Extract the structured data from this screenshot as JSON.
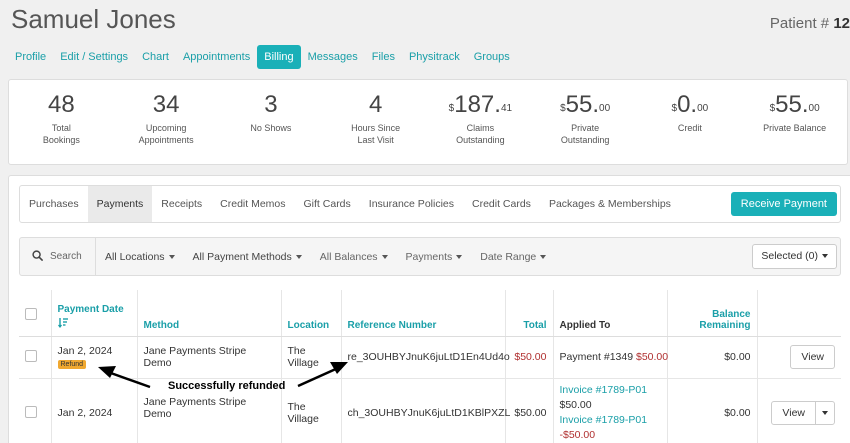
{
  "patient": {
    "name": "Samuel Jones",
    "number_label": "Patient # ",
    "number": "12"
  },
  "nav": {
    "tabs": [
      {
        "label": "Profile"
      },
      {
        "label": "Edit / Settings"
      },
      {
        "label": "Chart"
      },
      {
        "label": "Appointments"
      },
      {
        "label": "Billing",
        "active": true
      },
      {
        "label": "Messages"
      },
      {
        "label": "Files"
      },
      {
        "label": "Physitrack"
      },
      {
        "label": "Groups"
      }
    ]
  },
  "stats": [
    {
      "main": "48",
      "sup": "",
      "prefix": "",
      "label1": "Total",
      "label2": "Bookings"
    },
    {
      "main": "34",
      "sup": "",
      "prefix": "",
      "label1": "Upcoming",
      "label2": "Appointments"
    },
    {
      "main": "3",
      "sup": "",
      "prefix": "",
      "label1": "No Shows",
      "label2": ""
    },
    {
      "main": "4",
      "sup": "",
      "prefix": "",
      "label1": "Hours Since",
      "label2": "Last Visit"
    },
    {
      "main": "187.",
      "sup": "41",
      "prefix": "$",
      "label1": "Claims",
      "label2": "Outstanding"
    },
    {
      "main": "55.",
      "sup": "00",
      "prefix": "$",
      "label1": "Private",
      "label2": "Outstanding"
    },
    {
      "main": "0.",
      "sup": "00",
      "prefix": "$",
      "label1": "Credit",
      "label2": ""
    },
    {
      "main": "55.",
      "sup": "00",
      "prefix": "$",
      "label1": "Private Balance",
      "label2": ""
    }
  ],
  "subtabs": {
    "items": [
      {
        "label": "Purchases"
      },
      {
        "label": "Payments",
        "active": true
      },
      {
        "label": "Receipts"
      },
      {
        "label": "Credit Memos"
      },
      {
        "label": "Gift Cards"
      },
      {
        "label": "Insurance Policies"
      },
      {
        "label": "Credit Cards"
      },
      {
        "label": "Packages & Memberships"
      }
    ],
    "receive_payment": "Receive Payment"
  },
  "filters": {
    "search_placeholder": "Search",
    "locations": "All Locations",
    "payment_methods": "All Payment Methods",
    "balances": "All Balances",
    "payments": "Payments",
    "date_range": "Date Range",
    "selected": "Selected (0)"
  },
  "table": {
    "headers": {
      "payment_date": "Payment Date",
      "method": "Method",
      "location": "Location",
      "reference": "Reference Number",
      "total": "Total",
      "applied_to": "Applied To",
      "balance1": "Balance",
      "balance2": "Remaining"
    },
    "rows": [
      {
        "date": "Jan 2, 2024",
        "badge": "Refund",
        "method": "Jane Payments Stripe Demo",
        "location1": "The",
        "location2": "Village",
        "reference": "re_3OUHBYJnuK6juLtD1En4Ud4o",
        "total": "$50.00",
        "applied_text": "Payment #1349",
        "applied_amount": "$50.00",
        "balance": "$0.00",
        "view": "View"
      },
      {
        "date": "Jan 2, 2024",
        "method": "Jane Payments Stripe Demo",
        "location1": "The",
        "location2": "Village",
        "reference": "ch_3OUHBYJnuK6juLtD1KBlPXZL",
        "total": "$50.00",
        "inv1": "Invoice #1789-P01",
        "amt1": "$50.00",
        "inv2": "Invoice #1789-P01",
        "amt2": "-$50.00",
        "balance": "$0.00",
        "view": "View"
      }
    ]
  },
  "annotation": {
    "label": "Successfully refunded"
  },
  "colors": {
    "accent": "#1ab0b8",
    "link": "#1a9fa8",
    "negative": "#b03030",
    "refund_badge": "#f0a830"
  }
}
